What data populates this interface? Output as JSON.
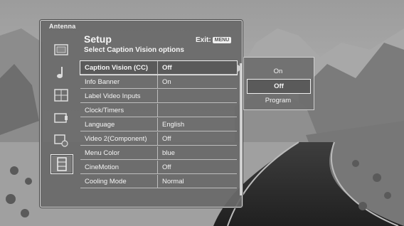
{
  "osd": {
    "source": "Antenna",
    "title": "Setup",
    "subtitle": "Select Caption Vision options",
    "exit_label": "Exit:",
    "exit_key": "MENU"
  },
  "side_icons": [
    "picture-icon",
    "audio-icon",
    "channel-icon",
    "lock-icon",
    "timer-icon",
    "setup-icon"
  ],
  "menu": {
    "items": [
      {
        "label": "Caption Vision (CC)",
        "value": "Off"
      },
      {
        "label": "Info Banner",
        "value": "On"
      },
      {
        "label": "Label Video Inputs",
        "value": ""
      },
      {
        "label": "Clock/Timers",
        "value": ""
      },
      {
        "label": "Language",
        "value": "English"
      },
      {
        "label": "Video 2(Component)",
        "value": "Off"
      },
      {
        "label": "Menu Color",
        "value": "blue"
      },
      {
        "label": "CineMotion",
        "value": "Off"
      },
      {
        "label": "Cooling Mode",
        "value": "Normal"
      }
    ],
    "selected_index": 0
  },
  "dropdown": {
    "options": [
      "On",
      "Off",
      "Program"
    ],
    "selected_index": 1
  }
}
